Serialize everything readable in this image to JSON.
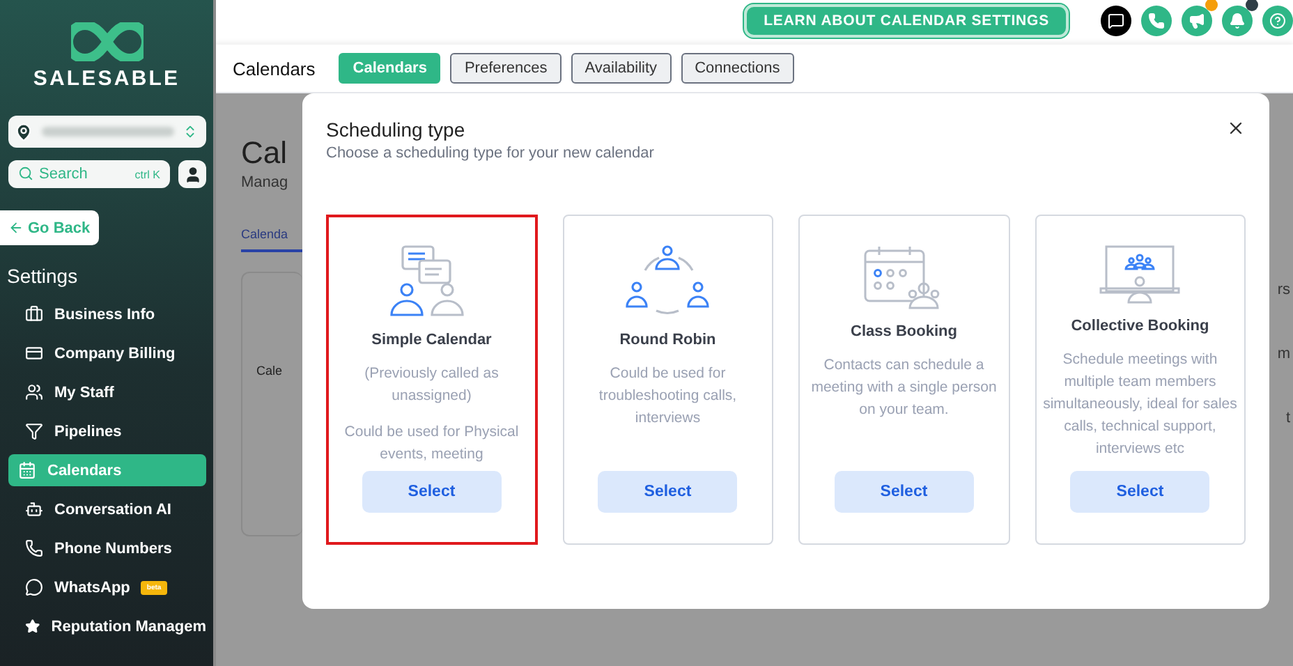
{
  "sidebar": {
    "brand": "SALESABLE",
    "search": {
      "placeholder": "Search",
      "shortcut": "ctrl K"
    },
    "back": "Go Back",
    "section": "Settings",
    "items": [
      {
        "label": "Business Info",
        "selected": false
      },
      {
        "label": "Company Billing",
        "selected": false
      },
      {
        "label": "My Staff",
        "selected": false
      },
      {
        "label": "Pipelines",
        "selected": false
      },
      {
        "label": "Calendars",
        "selected": true
      },
      {
        "label": "Conversation AI",
        "selected": false
      },
      {
        "label": "Phone Numbers",
        "selected": false
      },
      {
        "label": "WhatsApp",
        "selected": false,
        "badge": "beta"
      },
      {
        "label": "Reputation Managem",
        "selected": false
      }
    ]
  },
  "topbar": {
    "learn_button": "LEARN ABOUT CALENDAR SETTINGS",
    "icons": [
      {
        "kind": "chat"
      },
      {
        "kind": "phone"
      },
      {
        "kind": "megaphone",
        "color": "#f59e0b"
      },
      {
        "kind": "bell",
        "color": "#2f3e46"
      },
      {
        "kind": "help"
      }
    ]
  },
  "subnav": {
    "title": "Calendars",
    "tabs": [
      {
        "label": "Calendars",
        "selected": true
      },
      {
        "label": "Preferences",
        "selected": false
      },
      {
        "label": "Availability",
        "selected": false
      },
      {
        "label": "Connections",
        "selected": false
      }
    ]
  },
  "background": {
    "heading": "Cal",
    "subtitle": "Manag",
    "tab": "Calenda",
    "column_header": "Cale",
    "right_fragments": [
      "rs",
      "m",
      "t"
    ]
  },
  "modal": {
    "title": "Scheduling type",
    "subtitle": "Choose a scheduling type for your new calendar",
    "options": [
      {
        "kind": "simple",
        "title": "Simple Calendar",
        "descriptions": [
          "(Previously called as unassigned)",
          "Could be used for Physical events, meeting"
        ],
        "button": "Select",
        "selected": true
      },
      {
        "kind": "round_robin",
        "title": "Round Robin",
        "descriptions": [
          "Could be used for troubleshooting calls, interviews"
        ],
        "button": "Select",
        "selected": false
      },
      {
        "kind": "class",
        "title": "Class Booking",
        "descriptions": [
          "Contacts can schedule a meeting with a single person on your team."
        ],
        "button": "Select",
        "selected": false
      },
      {
        "kind": "collective",
        "title": "Collective Booking",
        "descriptions": [
          "Schedule meetings with multiple team members simultaneously, ideal for sales calls, technical support, interviews etc"
        ],
        "button": "Select",
        "selected": false
      }
    ]
  }
}
